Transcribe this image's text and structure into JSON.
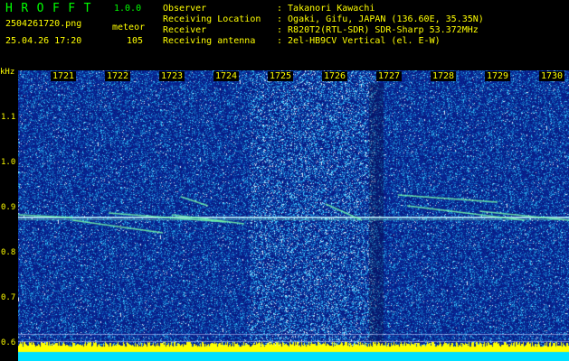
{
  "app": {
    "title": "HROFFT",
    "version": "1.0.0"
  },
  "file": {
    "name": "2504261720.png",
    "mode": "meteor",
    "datetime": "25.04.26 17:20",
    "count": "105"
  },
  "info": [
    {
      "label": "Observer",
      "value": ": Takanori Kawachi"
    },
    {
      "label": "Receiving Location",
      "value": ": Ogaki, Gifu, JAPAN (136.60E, 35.35N)"
    },
    {
      "label": "Receiver",
      "value": ": R820T2(RTL-SDR) SDR-Sharp 53.372MHz"
    },
    {
      "label": "Receiving antenna",
      "value": ": 2el-HB9CV Vertical (el. E-W)"
    }
  ],
  "axis": {
    "unit": "kHz",
    "y_ticks": [
      "1.1",
      "1.0",
      "0.9",
      "0.8",
      "0.7",
      "0.6"
    ],
    "minutes": [
      "1721",
      "1722",
      "1723",
      "1724",
      "1725",
      "1726",
      "1727",
      "1728",
      "1729",
      "1730"
    ]
  },
  "colors": {
    "label": "#ffff00",
    "title": "#00ff00",
    "background": "#000000"
  }
}
